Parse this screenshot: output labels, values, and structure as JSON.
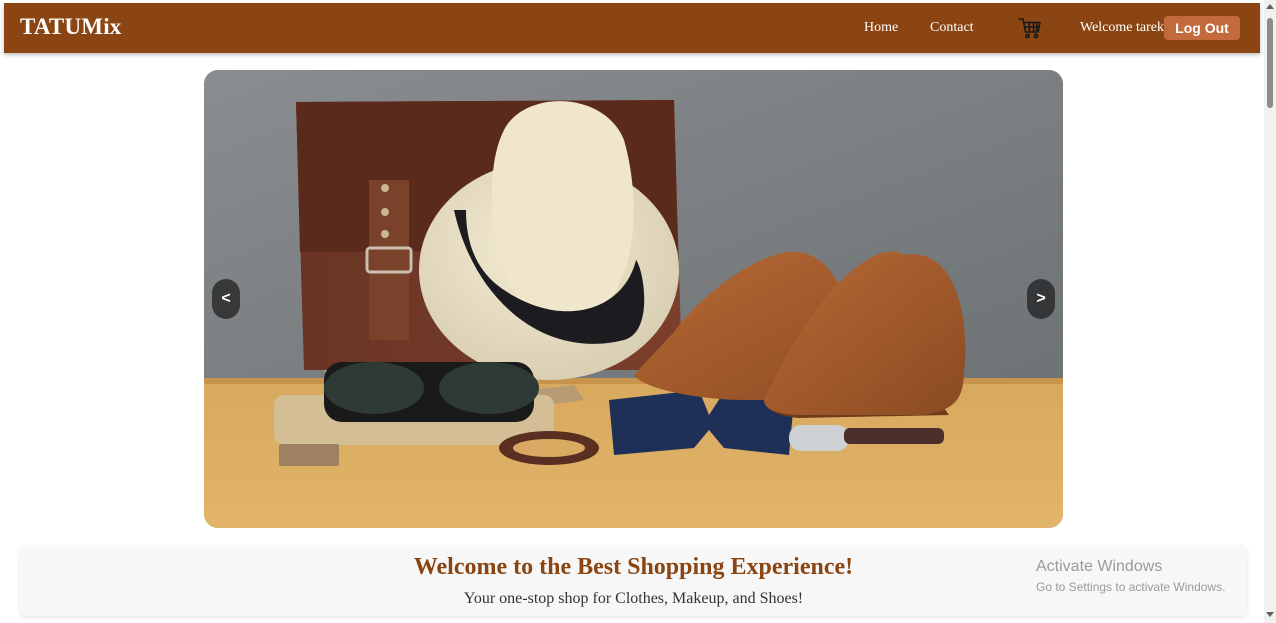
{
  "navbar": {
    "brand": "TATUMix",
    "links": [
      {
        "label": "Home"
      },
      {
        "label": "Contact"
      }
    ],
    "cart_icon": "cart-icon",
    "welcome_text": "Welcome tarek",
    "logout_label": "Log Out",
    "background": "#8a4512",
    "logout_color": "#c26a3c"
  },
  "carousel": {
    "prev_label": "<",
    "next_label": ">"
  },
  "hero": {
    "title": "Welcome to the Best Shopping Experience!",
    "subtitle": "Your one-stop shop for Clothes, Makeup, and Shoes!",
    "title_color": "#8a4512"
  },
  "os_watermark": {
    "title": "Activate Windows",
    "subtitle": "Go to Settings to activate Windows."
  }
}
